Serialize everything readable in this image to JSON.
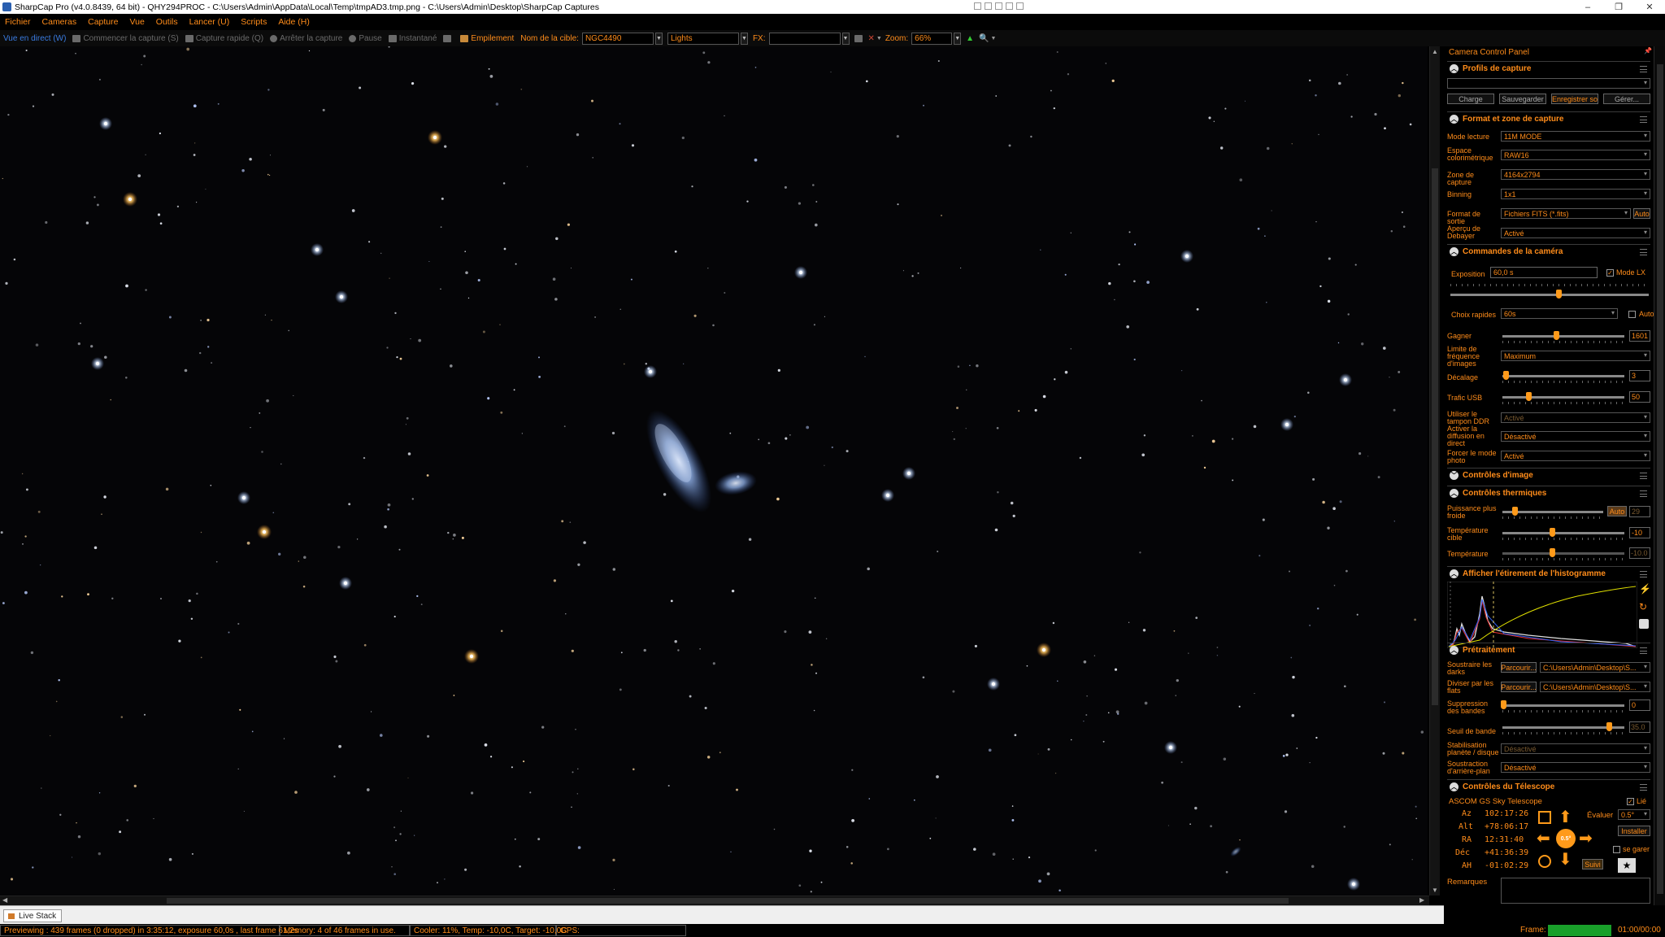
{
  "window": {
    "title": "SharpCap Pro (v4.0.8439, 64 bit) - QHY294PROC - C:\\Users\\Admin\\AppData\\Local\\Temp\\tmpAD3.tmp.png - C:\\Users\\Admin\\Desktop\\SharpCap Captures",
    "minimize": "–",
    "maximize": "❐",
    "close": "✕"
  },
  "menu": [
    "Fichier",
    "Cameras",
    "Capture",
    "Vue",
    "Outils",
    "Lancer (U)",
    "Scripts",
    "Aide (H)"
  ],
  "toolbar": {
    "live_view": "Vue en direct (W)",
    "start_capture": "Commencer la capture (S)",
    "quick_capture": "Capture rapide (Q)",
    "stop_capture": "Arrêter la capture",
    "pause": "Pause",
    "snapshot": "Instantané",
    "stacking": "Empilement",
    "target_label": "Nom de la cible:",
    "target_value": "NGC4490",
    "frame_type": "Lights",
    "fx_label": "FX:",
    "fx_value": "",
    "zoom_label": "Zoom:",
    "zoom_value": "66%"
  },
  "live_stack_tab": "Live Stack",
  "status": {
    "preview": "Previewing : 439 frames (0 dropped) in 3:35:12, exposure 60,0s , last frame 61,2s",
    "memory": "Memory: 4 of 46 frames in use.",
    "cooler": "Cooler: 11%, Temp: -10,0C, Target: -10,0C",
    "gps": "GPS:",
    "frame_label": "Frame:",
    "frame_time": "01:00/00:00",
    "frame_progress": 1.0
  },
  "panel": {
    "title": "Camera Control Panel",
    "pin": "📌",
    "profiles": {
      "header": "Profils de capture",
      "selected": "",
      "buttons": [
        "Charge",
        "Sauvegarder",
        "Enregistrer so",
        "Gérer..."
      ]
    },
    "format": {
      "header": "Format et zone de capture",
      "read_mode_label": "Mode lecture",
      "read_mode": "11M MODE",
      "colour_space_label": "Espace colorimétrique",
      "colour_space": "RAW16",
      "capture_area_label": "Zone de capture",
      "capture_area": "4164x2794",
      "binning_label": "Binning",
      "binning": "1x1",
      "output_format_label": "Format de sortie",
      "output_format": "Fichiers FITS (*.fits)",
      "output_auto": "Auto",
      "debayer_label": "Aperçu de Debayer",
      "debayer": "Activé"
    },
    "camera": {
      "header": "Commandes de la caméra",
      "exposure_label": "Exposition",
      "exposure": "60,0 s",
      "lx_mode_label": "Mode LX",
      "lx_mode": true,
      "quick_choice_label": "Choix rapides",
      "quick_choice": "60s",
      "quick_auto": "Auto",
      "gain_label": "Gagner",
      "gain": "1601",
      "fps_limit_label": "Limite de fréquence d'images",
      "fps_limit": "Maximum",
      "offset_label": "Décalage",
      "offset": "3",
      "usb_label": "Trafic USB",
      "usb": "50",
      "ddr_label": "Utiliser le tampon DDR",
      "ddr": "Activé",
      "stream_label": "Activer la diffusion en direct",
      "stream": "Désactivé",
      "photo_label": "Forcer le mode photo",
      "photo": "Activé"
    },
    "image_controls": {
      "header": "Contrôles d'image"
    },
    "thermal": {
      "header": "Contrôles thermiques",
      "power_label": "Puissance plus froide",
      "power_auto": "Auto",
      "power": "29",
      "target_label": "Température cible",
      "target": "-10",
      "temp_label": "Température",
      "temp": "-10.0"
    },
    "histogram": {
      "header": "Afficher l'étirement de l'histogramme"
    },
    "preprocess": {
      "header": "Prétraitement",
      "darks_label": "Soustraire les darks",
      "darks_browse": "Parcourir...",
      "darks_path": "C:\\Users\\Admin\\Desktop\\S...",
      "flats_label": "Diviser par les flats",
      "flats_browse": "Parcourir...",
      "flats_path": "C:\\Users\\Admin\\Desktop\\S...",
      "banding_label": "Suppression des bandes",
      "banding": "0",
      "band_threshold_label": "Seuil de bande",
      "band_threshold": "35.0",
      "stabilisation_label": "Stabilisation planète / disque",
      "stabilisation": "Désactivé",
      "bg_sub_label": "Soustraction d'arrière-plan",
      "bg_sub": "Désactivé"
    },
    "telescope": {
      "header": "Contrôles du Télescope",
      "name": "ASCOM GS Sky Telescope",
      "linked_label": "Lié",
      "linked": true,
      "az_label": "Az",
      "az": "102:17:26",
      "alt_label": "Alt",
      "alt": "+78:06:17",
      "ra_label": "RA",
      "ra": "12:31:40",
      "dec_label": "Déc",
      "dec": "+41:36:39",
      "ah_label": "AH",
      "ah": "-01:02:29",
      "rate_label": "Évaluer",
      "rate": "0.5°",
      "install": "Installer",
      "park_label": "se garer",
      "track": "Suivi",
      "center": "0.5°"
    },
    "notes_label": "Remarques"
  },
  "colors": {
    "accent": "#ff8c1a",
    "background": "#000000",
    "frame_bar": "#19a02a",
    "live_view_blue": "#3a7be0"
  }
}
